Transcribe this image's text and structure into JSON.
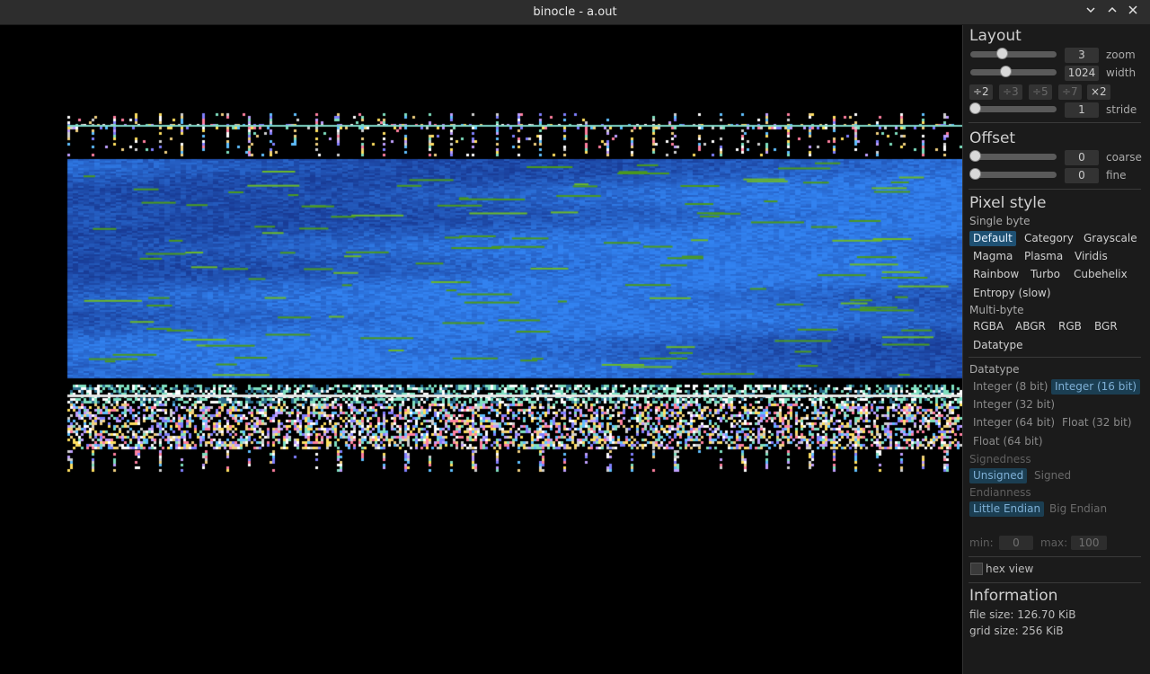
{
  "window": {
    "title": "binocle - a.out",
    "controls": [
      "minimize-icon",
      "maximize-icon",
      "close-icon"
    ]
  },
  "layout": {
    "heading": "Layout",
    "zoom": {
      "value": "3",
      "label": "zoom",
      "level": 0.3
    },
    "width": {
      "value": "1024",
      "label": "width",
      "level": 0.4
    },
    "width_buttons": [
      "÷2",
      "÷3",
      "÷5",
      "÷7",
      "×2"
    ],
    "stride": {
      "value": "1",
      "label": "stride",
      "level": 0
    }
  },
  "offset": {
    "heading": "Offset",
    "coarse": {
      "value": "0",
      "label": "coarse",
      "level": 0
    },
    "fine": {
      "value": "0",
      "label": "fine",
      "level": 0
    }
  },
  "pixel_style": {
    "heading": "Pixel style",
    "single_byte_label": "Single byte",
    "single_byte_options": [
      "Default",
      "Category",
      "Grayscale",
      "Magma",
      "Plasma",
      "Viridis",
      "Rainbow",
      "Turbo",
      "Cubehelix",
      "Entropy (slow)"
    ],
    "selected_single": "Default",
    "multi_byte_label": "Multi-byte",
    "multi_byte_options": [
      "RGBA",
      "ABGR",
      "RGB",
      "BGR",
      "Datatype"
    ]
  },
  "datatype": {
    "label": "Datatype",
    "options": [
      "Integer (8 bit)",
      "Integer (16 bit)",
      "Integer (32 bit)",
      "Integer (64 bit)",
      "Float (32 bit)",
      "Float (64 bit)"
    ],
    "selected": "Integer (16 bit)",
    "signedness_label": "Signedness",
    "signedness": [
      "Unsigned",
      "Signed"
    ],
    "selected_signedness": "Unsigned",
    "endianness_label": "Endianness",
    "endianness": [
      "Little Endian",
      "Big Endian"
    ],
    "selected_endianness": "Little Endian",
    "min_label": "min:",
    "min_value": "0",
    "max_label": "max:",
    "max_value": "100"
  },
  "hex_view": {
    "label": "hex view",
    "checked": false
  },
  "information": {
    "heading": "Information",
    "file_size": "file size: 126.70 KiB",
    "grid_size": "grid size: 256 KiB"
  },
  "colors": {
    "selected_bg": "#1f5173",
    "panel_bg": "#1b1b1b",
    "titlebar_bg": "#2d2d2d",
    "data_blue": "#2b5fc8",
    "data_green": "#4c9a1e"
  }
}
